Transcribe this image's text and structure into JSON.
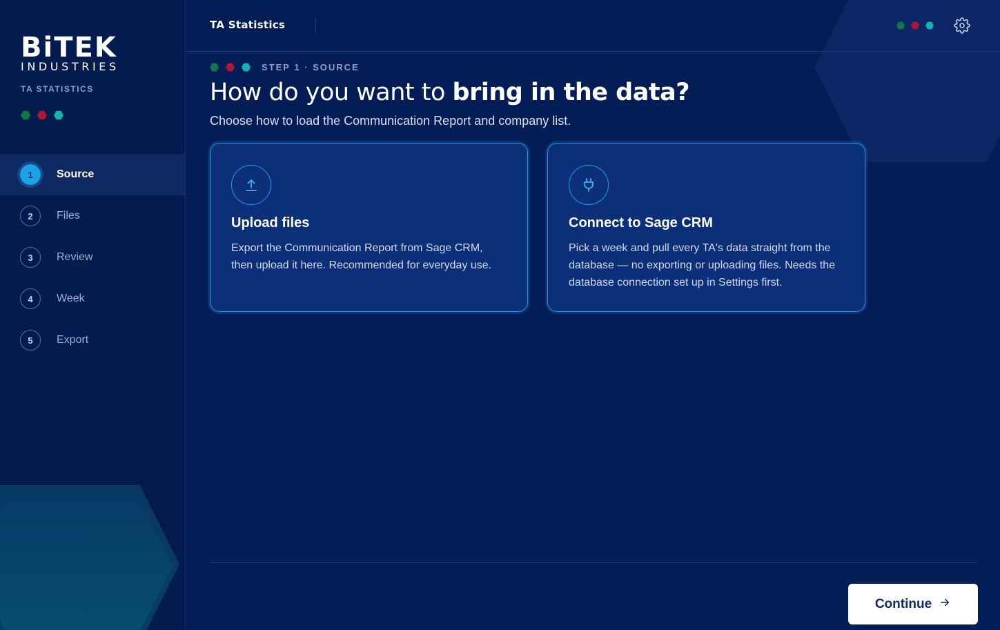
{
  "brand": {
    "logo_main": "BiTEK",
    "logo_sub": "INDUSTRIES",
    "tagline": "TA STATISTICS"
  },
  "colors": {
    "background": "#031d56",
    "sidebar": "#021c4f",
    "accent": "#1e9de0",
    "dot_green": "#0f7a45",
    "dot_red": "#b01635",
    "dot_teal": "#13b3b0"
  },
  "header": {
    "title": "TA Statistics",
    "settings_icon": "gear-icon"
  },
  "steps": [
    {
      "number": "1",
      "label": "Source",
      "active": true
    },
    {
      "number": "2",
      "label": "Files",
      "active": false
    },
    {
      "number": "3",
      "label": "Review",
      "active": false
    },
    {
      "number": "4",
      "label": "Week",
      "active": false
    },
    {
      "number": "5",
      "label": "Export",
      "active": false
    }
  ],
  "main": {
    "step_caption": "STEP 1 · SOURCE",
    "headline_regular": "How do you want to ",
    "headline_bold": "bring in the data?",
    "subhead": "Choose how to load the Communication Report and company list."
  },
  "options": [
    {
      "icon": "upload-icon",
      "title": "Upload files",
      "description": "Export the Communication Report from Sage CRM, then upload it here. Recommended for everyday use."
    },
    {
      "icon": "plug-icon",
      "title": "Connect to Sage CRM",
      "description": "Pick a week and pull every TA's data straight from the database — no exporting or uploading files. Needs the database connection set up in Settings first."
    }
  ],
  "footer": {
    "continue_label": "Continue",
    "continue_icon": "arrow-right-icon"
  }
}
